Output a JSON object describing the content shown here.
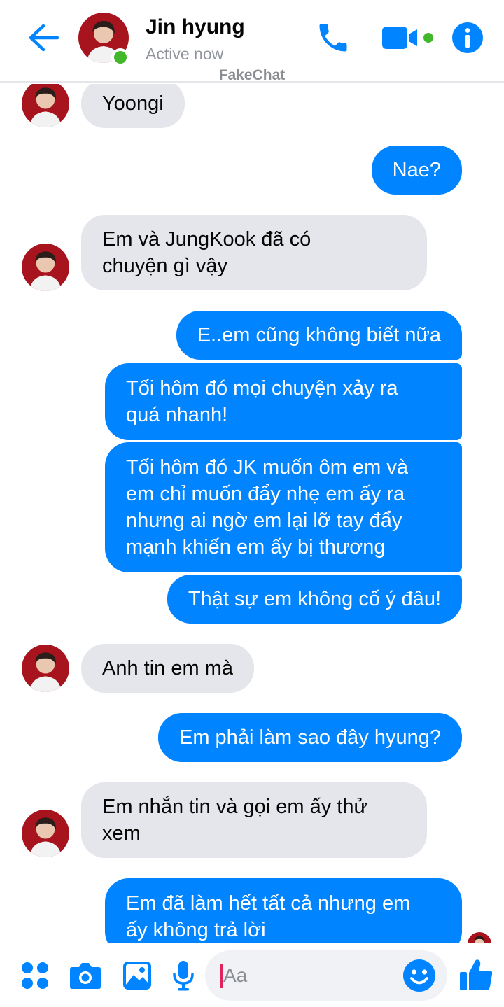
{
  "app": {
    "watermark": "FakeChat",
    "accent_color": "#0084ff"
  },
  "header": {
    "contact_name": "Jin hyung",
    "status": "Active now",
    "icons": [
      "back-arrow-icon",
      "phone-icon",
      "video-camera-icon",
      "info-icon"
    ]
  },
  "messages": [
    {
      "side": "in",
      "lines": [
        "Yoongi"
      ]
    },
    {
      "side": "out",
      "lines": [
        "Nae?"
      ]
    },
    {
      "side": "in",
      "lines": [
        "Em và JungKook đã có",
        "chuyện gì vậy"
      ]
    },
    {
      "side": "out",
      "lines": [
        "E..em cũng không biết nữa"
      ]
    },
    {
      "side": "out",
      "lines": [
        "Tối hôm đó mọi chuyện xảy ra",
        "quá nhanh!"
      ]
    },
    {
      "side": "out",
      "lines": [
        "Tối hôm đó JK muốn ôm em và",
        "em chỉ muốn đẩy nhẹ em ấy ra",
        "nhưng ai ngờ em lại lỡ tay đẩy",
        "mạnh khiến em ấy bị thương"
      ]
    },
    {
      "side": "out",
      "lines": [
        "Thật sự em không cố ý đâu!"
      ]
    },
    {
      "side": "in",
      "lines": [
        "Anh tin em mà"
      ]
    },
    {
      "side": "out",
      "lines": [
        "Em phải làm sao đây hyung?"
      ]
    },
    {
      "side": "in",
      "lines": [
        "Em nhắn tin và gọi em ấy thử",
        "xem"
      ]
    },
    {
      "side": "out",
      "lines": [
        "Em đã làm hết tất cả nhưng em",
        "ấy không trả lời"
      ]
    }
  ],
  "composer": {
    "placeholder": "Aa",
    "icons": [
      "apps-grid-icon",
      "camera-icon",
      "image-icon",
      "microphone-icon",
      "emoji-icon",
      "like-icon"
    ]
  }
}
